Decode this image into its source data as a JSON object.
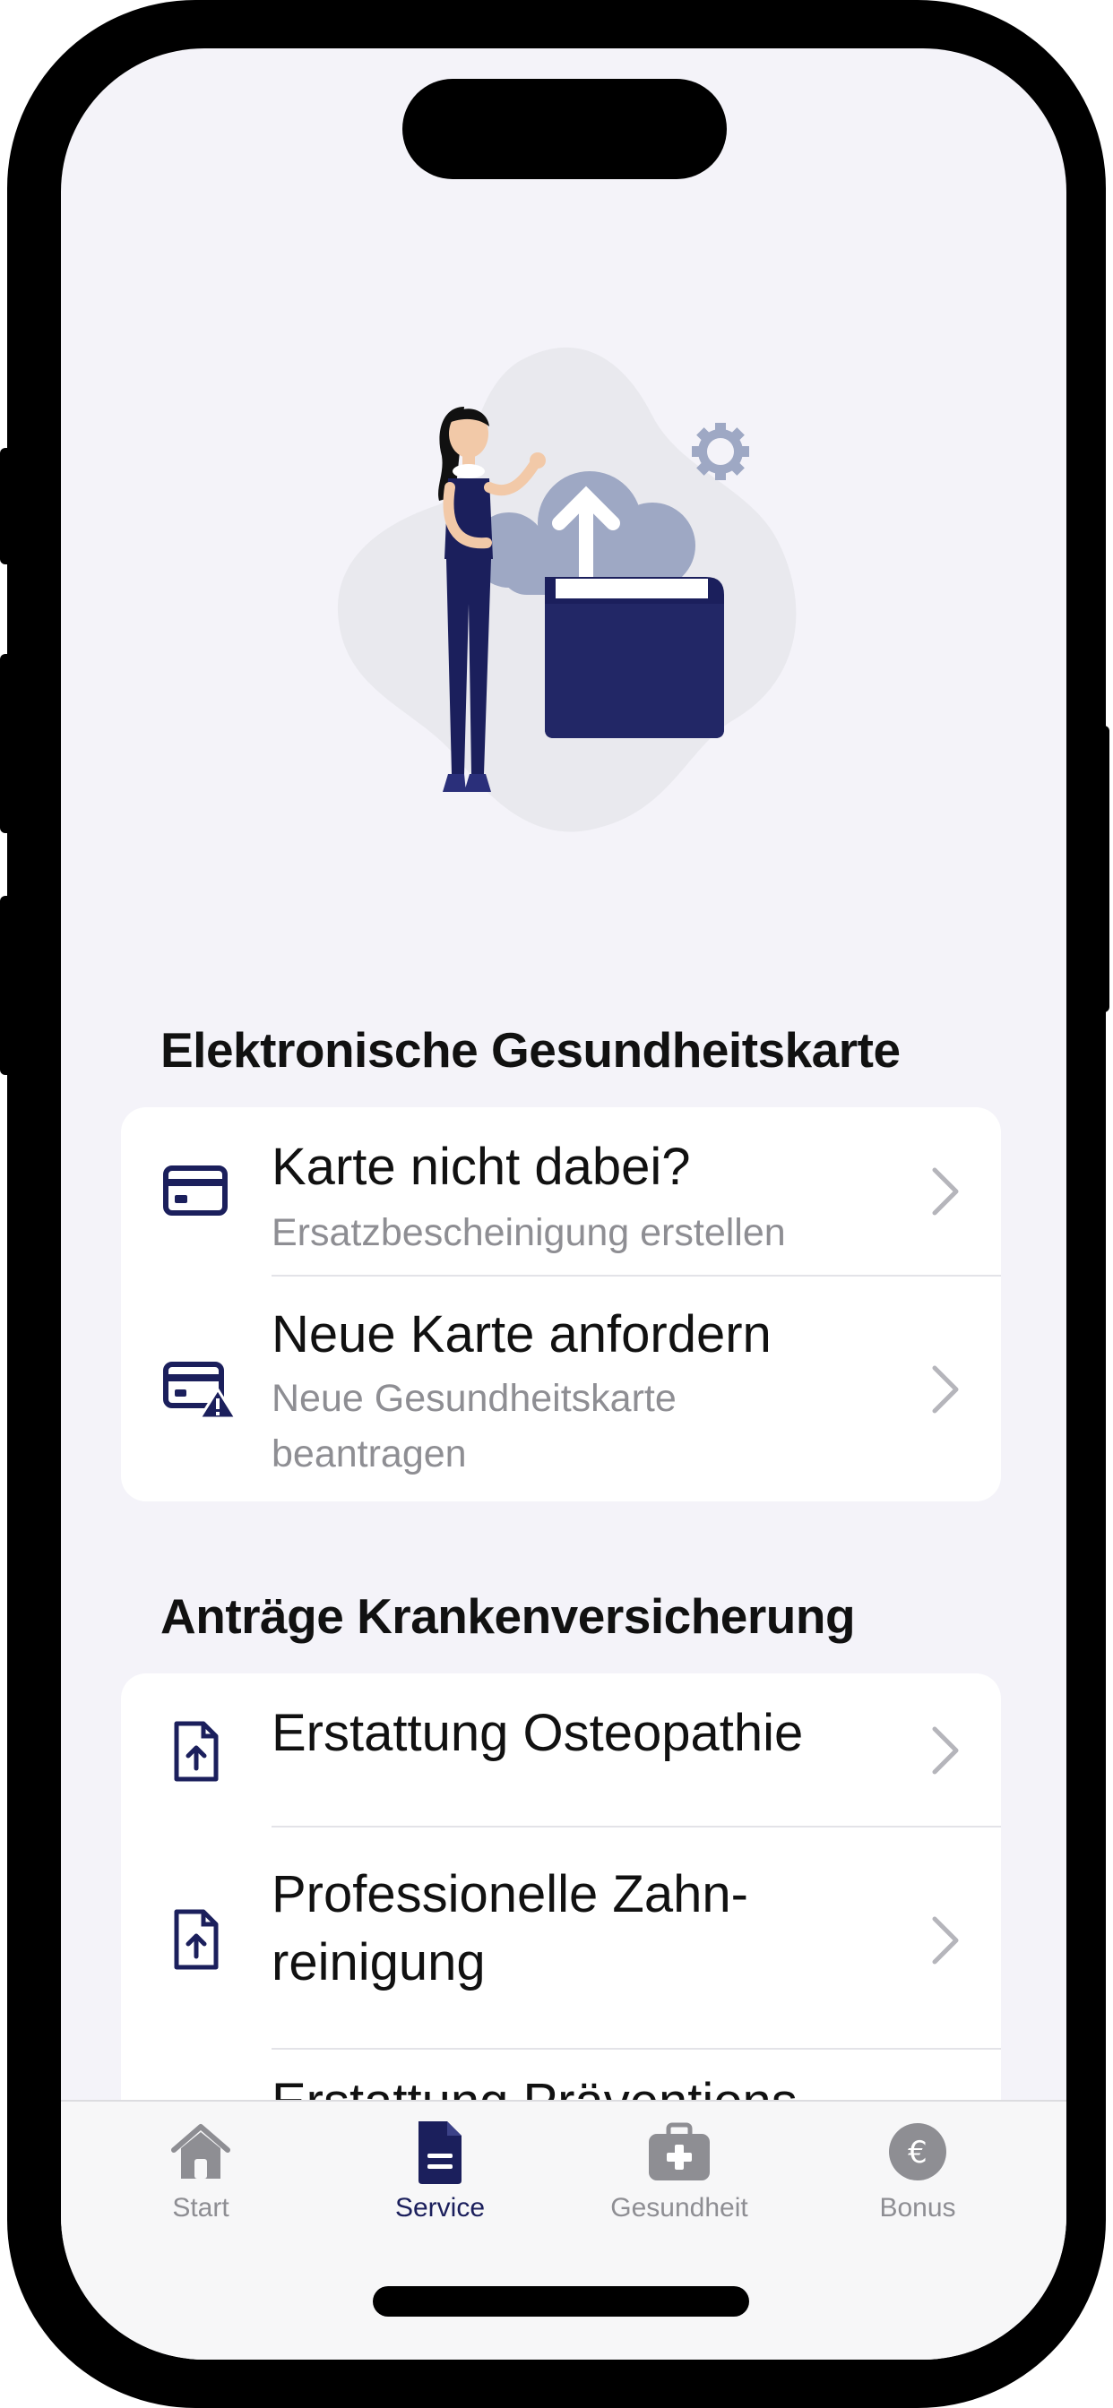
{
  "colors": {
    "accent": "#1b1f5c",
    "background": "#f4f3f9",
    "card": "#ffffff",
    "subtitle": "#8e8e93",
    "inactive_tab": "#8e8e93",
    "cloud": "#9ea8c4"
  },
  "hero": {
    "illustration": "woman-uploading-to-cloud-folder"
  },
  "sections": [
    {
      "title": "Elektronische Gesundheitskarte",
      "items": [
        {
          "icon": "card-icon",
          "title": "Karte nicht dabei?",
          "subtitle": "Ersatzbescheinigung erstellen"
        },
        {
          "icon": "card-warning-icon",
          "title": "Neue Karte anfordern",
          "subtitle_line1": "Neue Gesundheitskarte",
          "subtitle_line2": "beantragen"
        }
      ]
    },
    {
      "title": "Anträge Krankenversicherung",
      "items": [
        {
          "icon": "document-upload-icon",
          "title": "Erstattung Osteopathie"
        },
        {
          "icon": "document-upload-icon",
          "title_line1": "Professionelle Zahn-",
          "title_line2": "reinigung"
        },
        {
          "icon": "document-upload-icon",
          "title": "Erstattung Präventions"
        }
      ]
    }
  ],
  "tabbar": {
    "tabs": [
      {
        "icon": "home-icon",
        "label": "Start",
        "active": false
      },
      {
        "icon": "document-icon",
        "label": "Service",
        "active": true
      },
      {
        "icon": "medical-case-icon",
        "label": "Gesundheit",
        "active": false
      },
      {
        "icon": "euro-coin-icon",
        "label": "Bonus",
        "active": false
      }
    ]
  }
}
